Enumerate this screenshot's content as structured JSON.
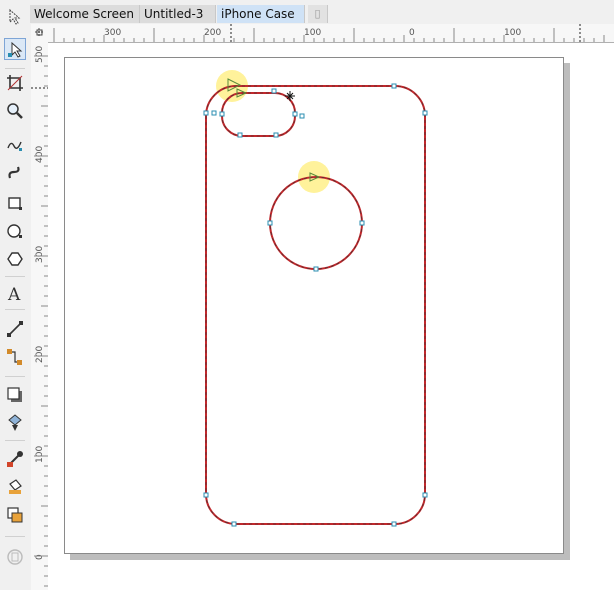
{
  "tabs": [
    {
      "label": "Welcome Screen"
    },
    {
      "label": "Untitled-3"
    },
    {
      "label": "iPhone Case",
      "active": true
    }
  ],
  "new_tab_icon": "new-document-tab-icon",
  "toolbar": {
    "tools": [
      {
        "name": "pick-tool",
        "icon": "pick-arrow-icon"
      },
      {
        "name": "shape-tool",
        "icon": "shape-node-icon",
        "selected": true
      },
      {
        "name": "crop-tool",
        "icon": "crop-icon"
      },
      {
        "name": "zoom-tool",
        "icon": "magnifier-icon"
      },
      {
        "name": "freehand-tool",
        "icon": "freehand-curve-icon"
      },
      {
        "name": "artistic-media-tool",
        "icon": "artistic-brush-icon"
      },
      {
        "name": "rectangle-tool",
        "icon": "rectangle-icon"
      },
      {
        "name": "ellipse-tool",
        "icon": "ellipse-icon"
      },
      {
        "name": "polygon-tool",
        "icon": "polygon-icon"
      },
      {
        "name": "text-tool",
        "icon": "text-a-icon"
      },
      {
        "name": "parallel-dimension-tool",
        "icon": "dimension-icon"
      },
      {
        "name": "connector-tool",
        "icon": "connector-icon"
      },
      {
        "name": "drop-shadow-tool",
        "icon": "drop-shadow-icon"
      },
      {
        "name": "transparency-tool",
        "icon": "transparency-icon"
      },
      {
        "name": "eyedropper-tool",
        "icon": "eyedropper-icon"
      },
      {
        "name": "interactive-fill-tool",
        "icon": "fill-bucket-icon"
      },
      {
        "name": "smart-fill-tool",
        "icon": "smart-fill-icon"
      },
      {
        "name": "add-tool-button",
        "icon": "plus-circle-icon"
      }
    ]
  },
  "rulers": {
    "horizontal_labels": [
      "300",
      "200",
      "100",
      "0",
      "100"
    ],
    "vertical_labels": [
      "500",
      "400",
      "300",
      "200",
      "100",
      "0"
    ]
  },
  "document": {
    "outline_color": "#c0282c",
    "handle_color": "#2a8db0",
    "highlight_color": "#fff08a"
  }
}
